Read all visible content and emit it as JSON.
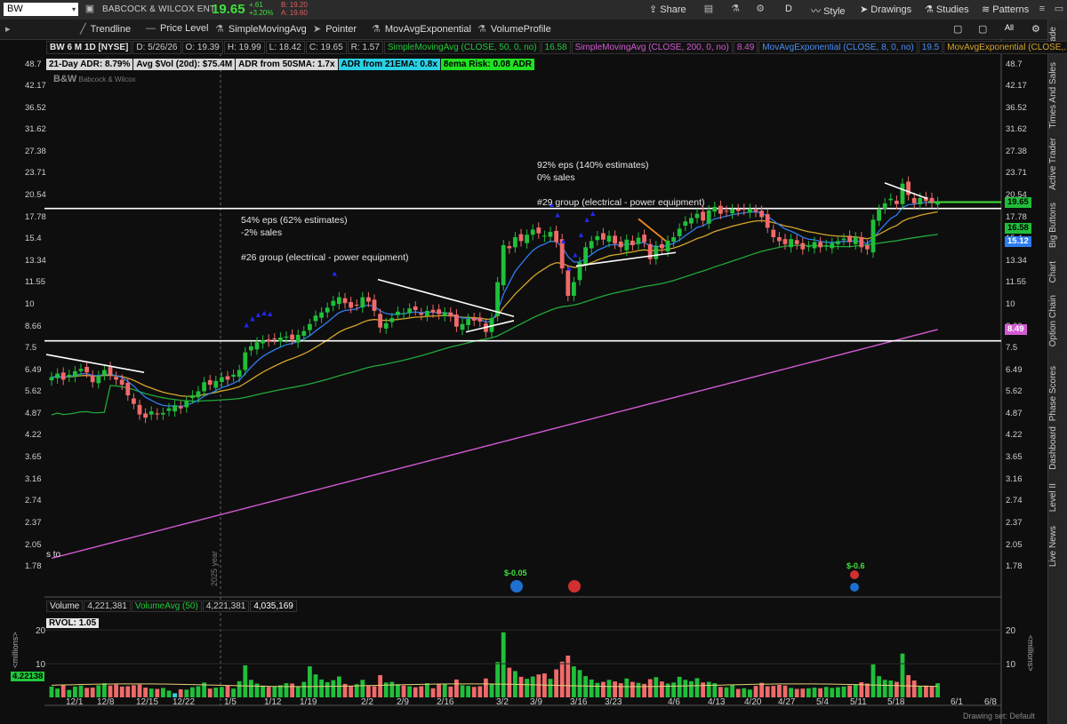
{
  "topbar": {
    "symbol": "BW",
    "company": "BABCOCK & WILCOX ENT",
    "last": "19.65",
    "change": "+.61",
    "change_pct": "+3.20%",
    "bid": "B: 19.20",
    "ask": "A: 19.60",
    "share_label": "Share",
    "timeframe": "D",
    "style_label": "Style",
    "drawings_label": "Drawings",
    "studies_label": "Studies",
    "patterns_label": "Patterns"
  },
  "toolbar": {
    "trendline": "Trendline",
    "price_level": "Price Level",
    "sma": "SimpleMovingAvg",
    "pointer": "Pointer",
    "ema": "MovAvgExponential",
    "volume_profile": "VolumeProfile",
    "all_label": "All"
  },
  "sidebar": [
    "Trade",
    "Times And Sales",
    "Active Trader",
    "Big Buttons",
    "Chart",
    "Option Chain",
    "Phase Scores",
    "Dashboard",
    "Level II",
    "Live News"
  ],
  "header_info": {
    "title": "BW 6 M 1D [NYSE]",
    "date": "D: 5/26/26",
    "open": "O: 19.39",
    "high": "H: 19.99",
    "low": "L: 18.42",
    "close": "C: 19.65",
    "range": "R: 1.57",
    "sma50": "SimpleMovingAvg (CLOSE, 50, 0, no)",
    "sma50_val": "16.58",
    "sma200": "SimpleMovingAvg (CLOSE, 200, 0, no)",
    "sma200_val": "8.49",
    "ema8": "MovAvgExponential (CLOSE, 8, 0, no)",
    "ema8_val": "19.5",
    "ema21": "MovAvgExponential (CLOSE,..."
  },
  "tags": {
    "adr": "21-Day ADR: 8.79%",
    "avgvol": "Avg $Vol (20d): $75.4M",
    "adr50": "ADR from 50SMA: 1.7x",
    "adr21": "ADR from 21EMA: 0.8x",
    "risk": "8ema Risk: 0.08 ADR"
  },
  "logo_text": "Babcock & Wilcox",
  "annotations": {
    "note1_l1": "54% eps (62% estimates)",
    "note1_l2": "-2% sales",
    "note1_l3": "#26 group (electrical - power equipment)",
    "note2_l1": "92% eps (140% estimates)",
    "note2_l2": "0% sales",
    "note2_l3": "#29 group (electrical - power equipment)",
    "year_marker": "2025 year",
    "left_fragment": "s to",
    "earn1": "$-0.05",
    "earn2": "$-0.6"
  },
  "volume_header": {
    "label": "Volume",
    "value": "4,221,381",
    "avg_label": "VolumeAvg (50)",
    "avg_val": "4,221,381",
    "avg_val2": "4,035,169",
    "rvol": "RVOL: 1.05",
    "current_tag": "4.22138",
    "axis_label": "<millions>"
  },
  "drawing_set": "Drawing set: Default",
  "colors": {
    "up": "#1fbf3a",
    "down": "#f06a6a",
    "sma50": "#21a83a",
    "sma200": "#d25ad2",
    "ema8": "#2e7cf0",
    "ema21": "#d6a52a",
    "accent_green": "#3fe03f"
  },
  "chart_data": {
    "type": "candlestick",
    "y_scale": "log",
    "ylim": [
      1.6,
      50
    ],
    "y_ticks": [
      "48.7",
      "42.17",
      "36.52",
      "31.62",
      "27.38",
      "23.71",
      "20.54",
      "17.78",
      "15.4",
      "13.34",
      "11.55",
      "10",
      "8.66",
      "7.5",
      "6.49",
      "5.62",
      "4.87",
      "4.22",
      "3.65",
      "3.16",
      "2.74",
      "2.37",
      "2.05",
      "1.78"
    ],
    "x_ticks": [
      "12/1",
      "12/8",
      "12/15",
      "12/22",
      "1/5",
      "1/12",
      "1/19",
      "2/2",
      "2/9",
      "2/16",
      "3/2",
      "3/9",
      "3/16",
      "3/23",
      "4/6",
      "4/13",
      "4/20",
      "4/27",
      "5/4",
      "5/11",
      "5/18",
      "6/1",
      "6/8"
    ],
    "price_tags": [
      {
        "label": "19.65",
        "value": 19.65,
        "color": "#1fbf3a"
      },
      {
        "label": "16.58",
        "value": 16.58,
        "color": "#1fbf3a"
      },
      {
        "label": "15.12",
        "value": 15.12,
        "color": "#2e7cf0"
      },
      {
        "label": "8.49",
        "value": 8.49,
        "color": "#d25ad2"
      }
    ],
    "closes": [
      6.2,
      6.35,
      6.1,
      6.3,
      6.45,
      6.55,
      6.4,
      6.0,
      6.25,
      6.5,
      6.3,
      6.1,
      5.9,
      5.5,
      5.2,
      4.85,
      4.75,
      4.95,
      4.85,
      4.9,
      5.05,
      5.15,
      5.05,
      5.3,
      5.5,
      5.65,
      6.0,
      5.9,
      6.05,
      6.2,
      6.1,
      6.3,
      6.5,
      7.3,
      7.6,
      7.8,
      7.9,
      7.85,
      7.95,
      8.05,
      8.1,
      7.95,
      8.2,
      8.4,
      8.8,
      9.3,
      9.5,
      9.8,
      10.25,
      10.5,
      10.1,
      9.8,
      9.95,
      10.5,
      10.2,
      9.6,
      8.6,
      8.85,
      9.15,
      9.55,
      9.45,
      9.75,
      9.65,
      9.35,
      9.6,
      9.5,
      9.4,
      9.5,
      9.25,
      8.65,
      8.8,
      9.1,
      9.0,
      8.95,
      8.35,
      9.15,
      11.6,
      14.8,
      14.5,
      15.6,
      15.2,
      15.85,
      16.4,
      16.0,
      15.75,
      16.15,
      15.1,
      12.7,
      10.6,
      11.6,
      13.2,
      14.6,
      15.2,
      15.7,
      15.35,
      15.75,
      14.95,
      14.6,
      15.35,
      14.8,
      15.55,
      15.1,
      13.5,
      14.7,
      14.5,
      15.25,
      15.6,
      16.5,
      17.3,
      17.7,
      18.2,
      17.4,
      18.6,
      19.05,
      18.2,
      18.5,
      18.75,
      18.55,
      18.7,
      18.8,
      18.45,
      17.8,
      16.6,
      15.6,
      15.2,
      14.9,
      15.4,
      14.9,
      14.4,
      14.7,
      15.1,
      14.6,
      14.8,
      15.0,
      15.2,
      15.45,
      15.1,
      15.6,
      14.6,
      14.4,
      17.5,
      18.7,
      19.5,
      20.1,
      19.4,
      22.2,
      20.6,
      19.5,
      20.2,
      19.8,
      19.6,
      19.65
    ],
    "volume_millions": [
      3.2,
      2.6,
      3.6,
      2.2,
      3.2,
      3.5,
      2.8,
      2.9,
      3.6,
      4.2,
      3.5,
      3.8,
      3.2,
      3.3,
      3.6,
      3.8,
      2.9,
      2.6,
      2.5,
      2.8,
      2.0,
      1.2,
      2.4,
      2.3,
      3.0,
      3.3,
      4.4,
      2.6,
      2.9,
      3.1,
      3.5,
      2.6,
      4.8,
      9.5,
      5.2,
      4.1,
      3.5,
      3.1,
      3.3,
      3.6,
      4.2,
      4.1,
      3.2,
      4.6,
      9.2,
      6.8,
      5.3,
      4.5,
      5.1,
      6.2,
      4.0,
      3.4,
      3.9,
      5.2,
      3.4,
      3.3,
      6.6,
      4.4,
      4.6,
      3.9,
      3.5,
      3.3,
      3.0,
      3.3,
      4.2,
      2.7,
      3.8,
      3.9,
      3.2,
      5.3,
      3.6,
      3.4,
      3.1,
      3.3,
      5.6,
      4.1,
      10.5,
      19.3,
      8.8,
      7.8,
      6.1,
      5.5,
      6.2,
      6.8,
      7.1,
      5.5,
      8.3,
      10.6,
      12.4,
      9.2,
      8.1,
      6.3,
      5.3,
      4.3,
      4.6,
      5.2,
      4.7,
      4.2,
      5.6,
      4.6,
      4.3,
      4.0,
      5.4,
      6.0,
      4.7,
      4.1,
      4.4,
      6.1,
      5.2,
      4.8,
      5.7,
      4.4,
      4.6,
      4.2,
      3.1,
      3.0,
      3.8,
      2.5,
      2.7,
      2.3,
      3.4,
      4.3,
      3.3,
      3.4,
      3.7,
      3.5,
      2.8,
      2.5,
      2.6,
      2.7,
      2.9,
      2.7,
      3.1,
      2.8,
      3.0,
      3.2,
      3.5,
      3.7,
      4.5,
      4.1,
      9.8,
      6.3,
      5.2,
      5.0,
      4.6,
      13.0,
      6.6,
      5.0,
      3.4,
      3.5,
      3.3,
      4.2
    ],
    "sma200_endpoints": [
      [
        1.88,
        8.49
      ]
    ],
    "horizontal_levels": [
      7.88,
      18.85
    ],
    "volume_ylim": [
      0,
      24
    ],
    "volume_ticks": [
      "20",
      "10"
    ],
    "ema21_value": "ohlc only",
    "grid": false,
    "legend": "top"
  }
}
